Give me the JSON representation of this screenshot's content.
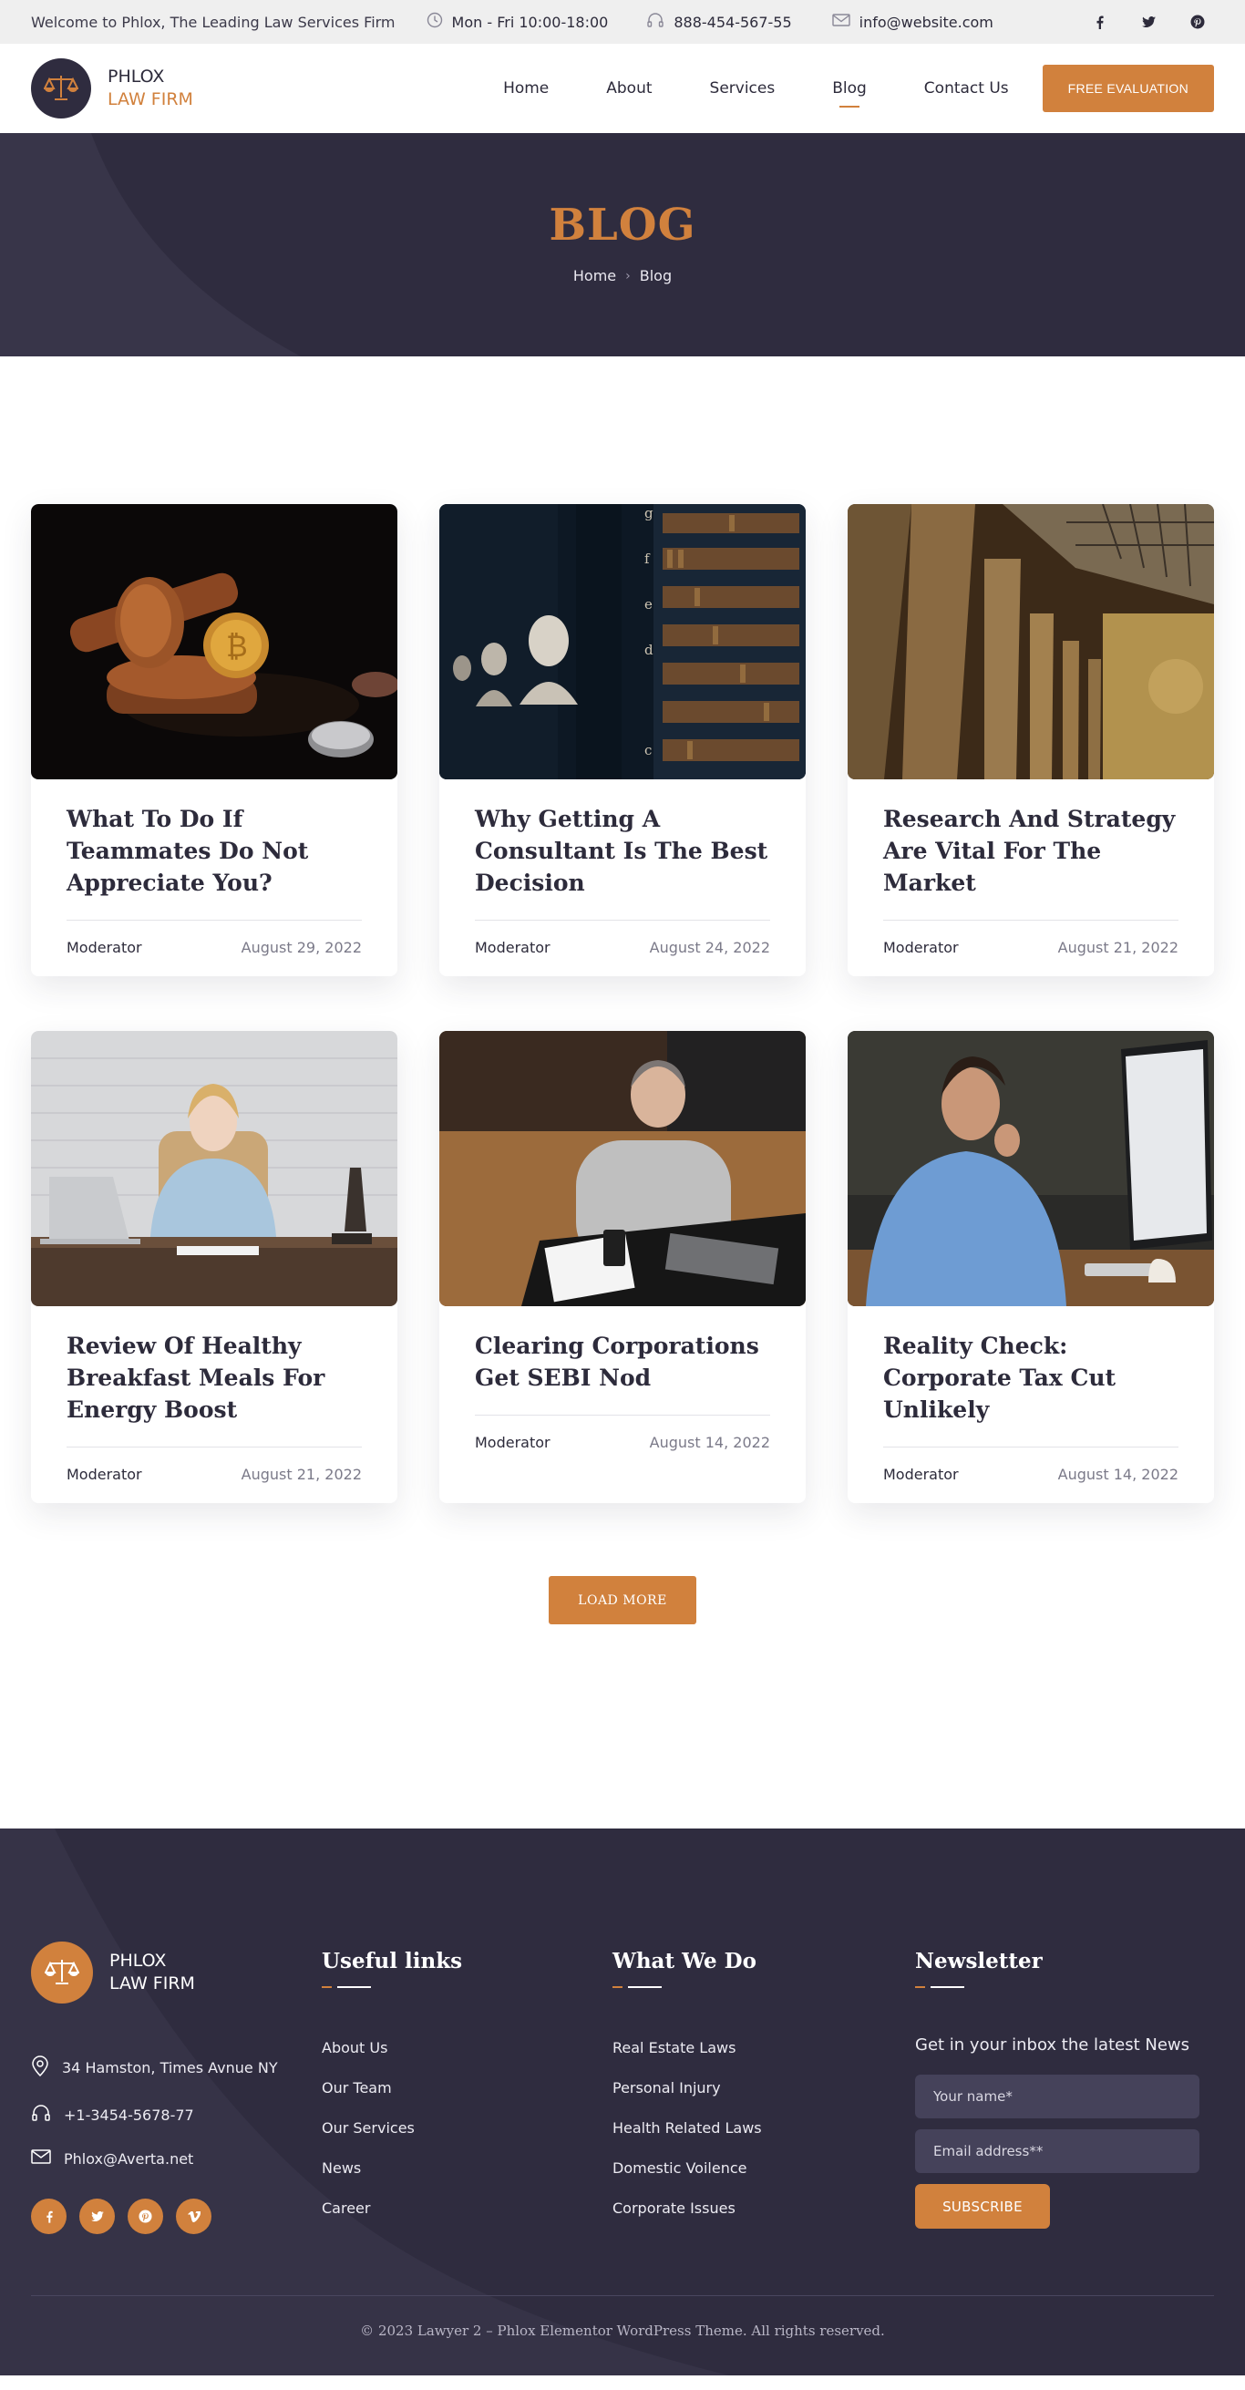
{
  "topbar": {
    "welcome": "Welcome to Phlox, The Leading Law Services Firm",
    "hours": "Mon - Fri 10:00-18:00",
    "phone": "888-454-567-55",
    "email": "info@website.com",
    "socials": [
      "facebook-icon",
      "twitter-icon",
      "pinterest-icon"
    ]
  },
  "header": {
    "logo_line1": "PHLOX",
    "logo_line2": "LAW FIRM",
    "nav": [
      "Home",
      "About",
      "Services",
      "Blog",
      "Contact Us"
    ],
    "active_nav": "Blog",
    "cta": "FREE EVALUATION"
  },
  "hero": {
    "title": "BLOG",
    "breadcrumb": [
      "Home",
      "Blog"
    ]
  },
  "posts": [
    {
      "title": "What To Do If Teammates Do Not Appreciate You?",
      "author": "Moderator",
      "date": "August 29, 2022",
      "image": "gavel-and-bitcoin"
    },
    {
      "title": "Why Getting A Consultant Is The Best Decision",
      "author": "Moderator",
      "date": "August 24, 2022",
      "image": "library-busts"
    },
    {
      "title": "Research And Strategy Are Vital For The Market",
      "author": "Moderator",
      "date": "August 21, 2022",
      "image": "courthouse-columns"
    },
    {
      "title": "Review Of Healthy Breakfast Meals For Energy Boost",
      "author": "Moderator",
      "date": "August 21, 2022",
      "image": "woman-at-desk"
    },
    {
      "title": "Clearing Corporations Get SEBI Nod",
      "author": "Moderator",
      "date": "August 14, 2022",
      "image": "man-with-laptop"
    },
    {
      "title": "Reality Check: Corporate Tax Cut Unlikely",
      "author": "Moderator",
      "date": "August 14, 2022",
      "image": "man-at-computer"
    }
  ],
  "load_more": "LOAD MORE",
  "footer": {
    "logo_line1": "PHLOX",
    "logo_line2": "LAW FIRM",
    "address": "34 Hamston, Times Avnue NY",
    "phone": "+1-3454-5678-77",
    "email": "Phlox@Averta.net",
    "socials": [
      "facebook-icon",
      "twitter-icon",
      "pinterest-icon",
      "vimeo-icon"
    ],
    "useful_links_title": "Useful links",
    "useful_links": [
      "About Us",
      "Our Team",
      "Our Services",
      "News",
      "Career"
    ],
    "what_we_do_title": "What We Do",
    "what_we_do": [
      "Real Estate Laws",
      "Personal Injury",
      "Health Related Laws",
      "Domestic Voilence",
      "Corporate Issues"
    ],
    "newsletter_title": "Newsletter",
    "newsletter_text": "Get in your inbox the latest News",
    "name_placeholder": "Your name*",
    "email_placeholder": "Email address**",
    "subscribe": "SUBSCRIBE",
    "copyright": "© 2023 Lawyer 2 – Phlox Elementor WordPress Theme. All rights reserved."
  },
  "colors": {
    "accent": "#d1813d",
    "dark": "#2f2c3f",
    "text": "#2d2b3b"
  }
}
